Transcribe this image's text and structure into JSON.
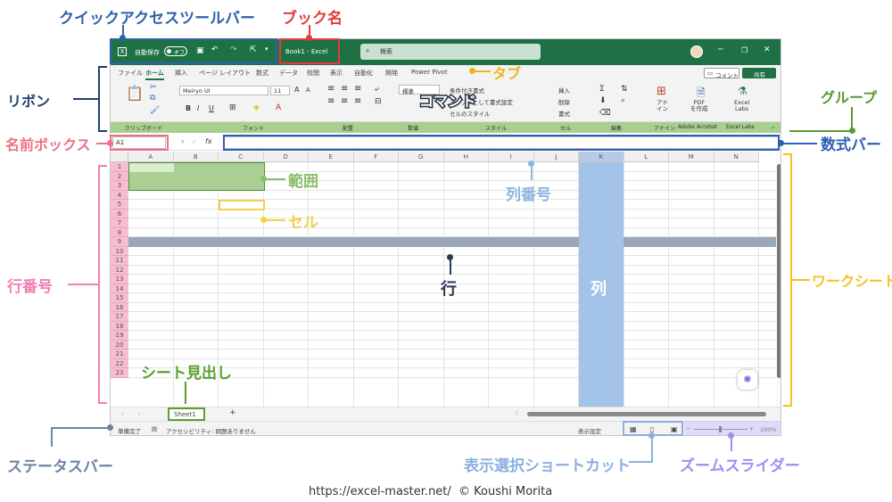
{
  "window": {
    "autosave_label": "自動保存",
    "autosave_state": "オフ",
    "book_title": "Book1 - Excel",
    "search_placeholder": "検索",
    "tabs": [
      "ファイル",
      "ホーム",
      "挿入",
      "ページ レイアウト",
      "数式",
      "データ",
      "校閲",
      "表示",
      "自動化",
      "開発",
      "Power Pivot"
    ],
    "comment_button": "コメント",
    "share_button": "共有",
    "ribbon": {
      "paste_label": "貼り付け",
      "font_name": "Meiryo UI",
      "font_size": "11",
      "number_format": "標準",
      "cond_format": "条件付き書式",
      "table_format": "テーブルとして書式設定",
      "cell_style": "セルのスタイル",
      "insert": "挿入",
      "delete": "削除",
      "format": "書式",
      "addin": "アド\nイン",
      "pdf": "PDF\nを作成",
      "excel_labs": "Excel\nLabs",
      "groups": [
        "クリップボード",
        "フォント",
        "配置",
        "数値",
        "スタイル",
        "セル",
        "編集",
        "アドイン",
        "Adobe Acrobat",
        "Excel Labs"
      ]
    },
    "name_box": "A1",
    "fx": "fx",
    "columns": [
      "A",
      "B",
      "C",
      "D",
      "E",
      "F",
      "G",
      "H",
      "I",
      "J",
      "K",
      "L",
      "M",
      "N"
    ],
    "rows": [
      "1",
      "2",
      "3",
      "4",
      "5",
      "6",
      "7",
      "8",
      "9",
      "10",
      "11",
      "12",
      "13",
      "14",
      "15",
      "16",
      "17",
      "18",
      "19",
      "20",
      "21",
      "22",
      "23"
    ],
    "sheet_tab": "Sheet1",
    "add_sheet": "+",
    "status": {
      "ready": "準備完了",
      "accessibility": "アクセシビリティ: 問題ありません",
      "display_settings": "表示設定",
      "zoom": "100%"
    }
  },
  "annotations": {
    "qat": "クイックアクセスツールバー",
    "book_name": "ブック名",
    "tab": "タブ",
    "ribbon": "リボン",
    "command": "コマンド",
    "group": "グループ",
    "name_box": "名前ボックス",
    "formula_bar": "数式バー",
    "range": "範囲",
    "column_number": "列番号",
    "cell": "セル",
    "row_number": "行番号",
    "row": "行",
    "column": "列",
    "worksheet": "ワークシート",
    "sheet_tab": "シート見出し",
    "status_bar": "ステータスバー",
    "view_shortcuts": "表示選択ショートカット",
    "zoom_slider": "ズームスライダー"
  },
  "colors": {
    "qat": "#2e62a8",
    "book_name": "#e63939",
    "tab": "#f0b51c",
    "ribbon": "#1f3f6e",
    "group": "#5a9a32",
    "name_box": "#ef6f84",
    "formula_bar": "#2d5fb5",
    "range": "#8cbf6a",
    "column_number": "#8fb4e3",
    "cell": "#f2d14a",
    "row_number": "#f27fb3",
    "row": "#2a3a55",
    "worksheet": "#f4c21f",
    "sheet_tab": "#5aa02c",
    "status_bar": "#6e84a6",
    "view_shortcuts": "#8cb0e0",
    "zoom_slider": "#9d8ff0"
  },
  "footer": "https://excel-master.net/  © Koushi Morita"
}
